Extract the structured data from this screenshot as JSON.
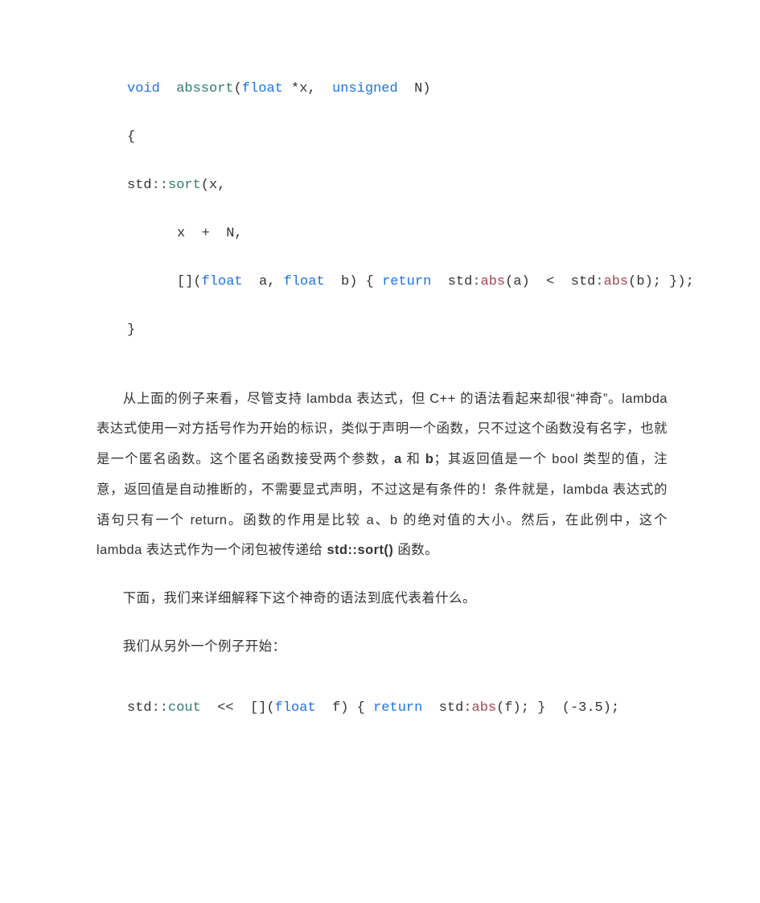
{
  "code1": {
    "l1": {
      "kw": "void",
      "sp": "  ",
      "fn": "abssort",
      "open": "(",
      "t1": "float",
      "arg1": " *x,  ",
      "t2": "unsigned",
      "arg2": "  N",
      "close": ")"
    },
    "l2": "{",
    "l3": {
      "std": "std",
      "dc": "::",
      "fn": "sort",
      "rest": "(x,"
    },
    "l4": "x  +  N,",
    "l5": {
      "cap": "[]",
      "open": "(",
      "t1": "float",
      "a1": "  a, ",
      "t2": "float",
      "a2": "  b",
      "close": ") { ",
      "ret": "return",
      "sp": "  ",
      "std1": "std",
      "dc1": ":",
      "fn1": "abs",
      "r1": "(a)  <  ",
      "std2": "std",
      "dc2": ":",
      "fn2": "abs",
      "r2": "(b); });"
    },
    "l6": "}"
  },
  "para1_a": "从上面的例子来看，尽管支持  lambda  表达式，但  C++  的语法看起来却很“神奇”。lambda  表达式使用一对方括号作为开始的标识，类似于声明一个函数，只不过这个函数没有名字，也就是一个匿名函数。这个匿名函数接受两个参数，",
  "para1_b": " 和 ",
  "para1_c": "；其返回值是一个  bool  类型的值，注意，返回值是自动推断的，不需要显式声明，不过这是有条件的！条件就是，lambda  表达式的语句只有一个  return。函数的作用是比较  a、b  的绝对值的大小。然后，在此例中，这个  lambda  表达式作为一个闭包被传递给  ",
  "para1_d": "  函数。",
  "bold_a": "a",
  "bold_b": "b",
  "bold_sort": "std::sort()",
  "para2": "下面，我们来详细解释下这个神奇的语法到底代表着什么。",
  "para3": "我们从另外一个例子开始：",
  "code2": {
    "std": "std",
    "dc": "::",
    "fn": "cout",
    "angle": "  <<  ",
    "cap": "[]",
    "open": "(",
    "t1": "float",
    "a1": "  f",
    "close": ") { ",
    "ret": "return",
    "sp": "  ",
    "std2": "std",
    "dc2": ":",
    "fn2": "abs",
    "rest": "(f); }  (-3.5);"
  }
}
